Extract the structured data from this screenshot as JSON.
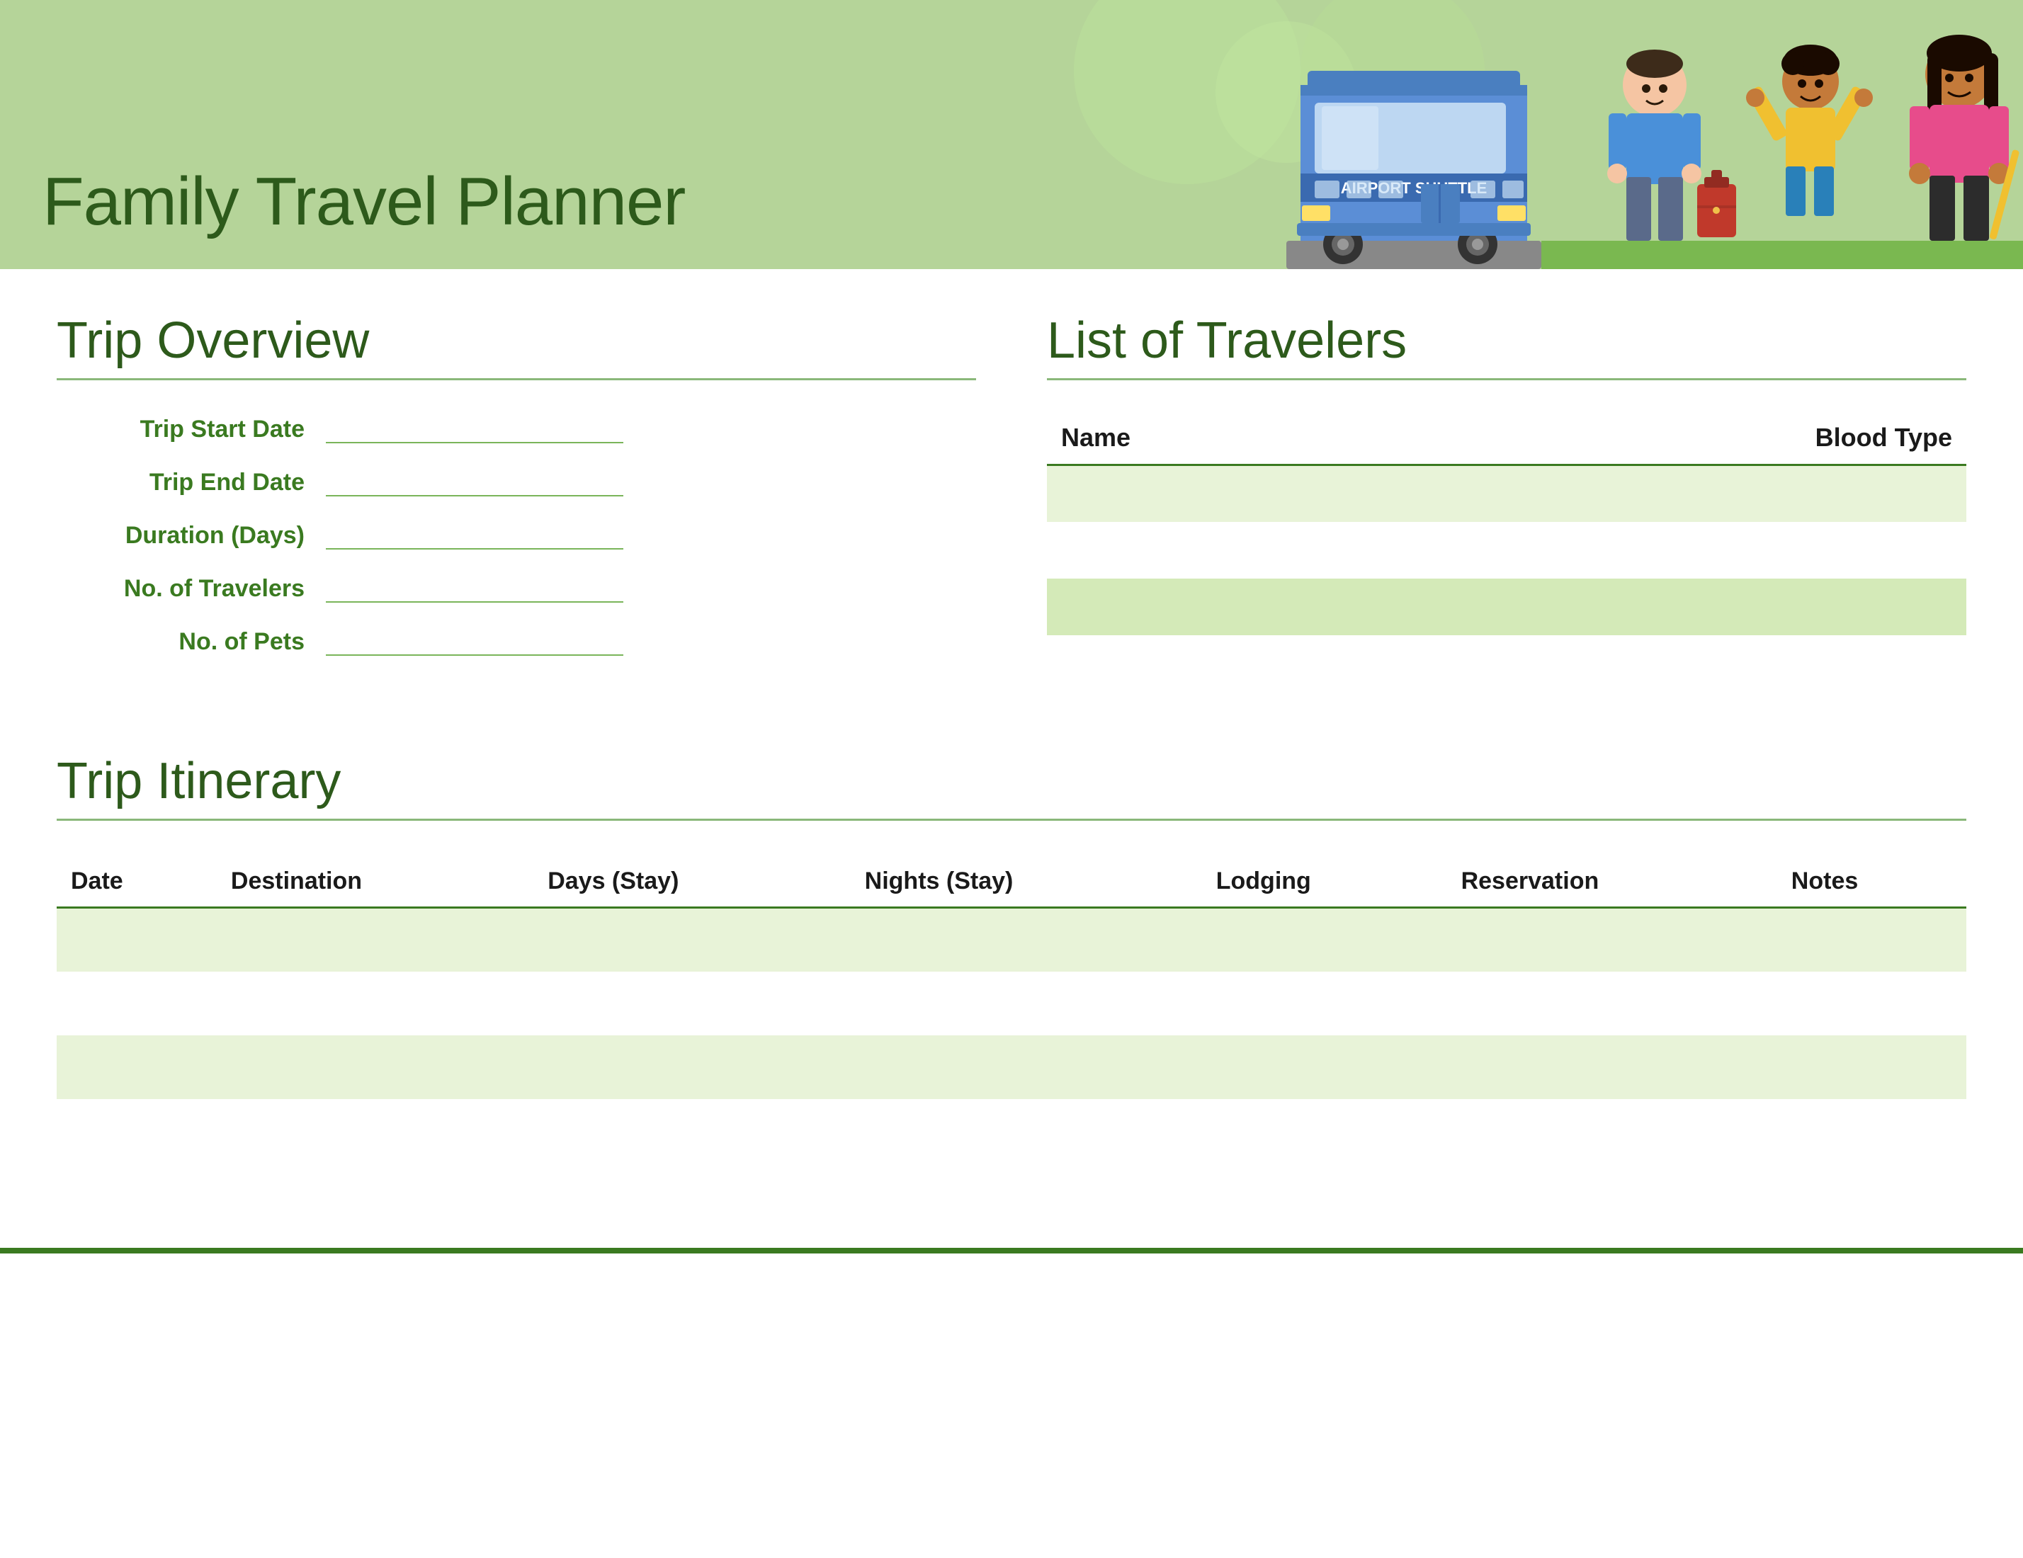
{
  "header": {
    "title": "Family Travel Planner",
    "bg_color": "#b5d499"
  },
  "trip_overview": {
    "section_title": "Trip Overview",
    "fields": [
      {
        "label": "Trip Start Date"
      },
      {
        "label": "Trip End Date"
      },
      {
        "label": "Duration (Days)"
      },
      {
        "label": "No. of Travelers"
      },
      {
        "label": "No. of Pets"
      }
    ]
  },
  "list_of_travelers": {
    "section_title": "List of Travelers",
    "columns": [
      "Name",
      "Blood Type"
    ],
    "rows": [
      {
        "name": "",
        "blood_type": ""
      },
      {
        "name": "",
        "blood_type": ""
      },
      {
        "name": "",
        "blood_type": ""
      }
    ]
  },
  "trip_itinerary": {
    "section_title": "Trip Itinerary",
    "columns": [
      "Date",
      "Destination",
      "Days (Stay)",
      "Nights (Stay)",
      "Lodging",
      "Reservation",
      "Notes"
    ],
    "rows": [
      {
        "date": "",
        "destination": "",
        "days": "",
        "nights": "",
        "lodging": "",
        "reservation": "",
        "notes": ""
      },
      {
        "date": "",
        "destination": "",
        "days": "",
        "nights": "",
        "lodging": "",
        "reservation": "",
        "notes": ""
      },
      {
        "date": "",
        "destination": "",
        "days": "",
        "nights": "",
        "lodging": "",
        "reservation": "",
        "notes": ""
      },
      {
        "date": "",
        "destination": "",
        "days": "",
        "nights": "",
        "lodging": "",
        "reservation": "",
        "notes": ""
      }
    ]
  },
  "colors": {
    "green_dark": "#2d5a1b",
    "green_medium": "#3a7a20",
    "green_light": "#b5d499",
    "green_row": "#e8f3d8",
    "accent_line": "#7ab55a"
  }
}
